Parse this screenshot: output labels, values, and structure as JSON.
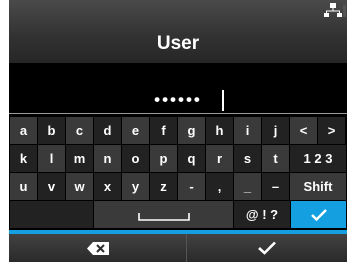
{
  "header": {
    "title": "User",
    "status_icon": "network-icon"
  },
  "input": {
    "value": "••••••"
  },
  "keyboard": {
    "rows": [
      [
        "a",
        "b",
        "c",
        "d",
        "e",
        "f",
        "g",
        "h",
        "i",
        "j",
        "<",
        ">"
      ],
      [
        "k",
        "l",
        "m",
        "n",
        "o",
        "p",
        "q",
        "r",
        "s",
        "t",
        "1 2 3"
      ],
      [
        "u",
        "v",
        "w",
        "x",
        "y",
        "z",
        "-",
        ",",
        "_",
        "–",
        "Shift"
      ]
    ],
    "space_key_icon": "space-icon",
    "symbols_label": "@ ! ?",
    "enter_key_icon": "checkmark-icon"
  },
  "bottom_bar": {
    "left_icon": "backspace-icon",
    "right_icon": "checkmark-icon"
  },
  "colors": {
    "accent": "#14a0e0",
    "key_bg": "#3a3a3a",
    "key_bg_dark": "#222222"
  }
}
